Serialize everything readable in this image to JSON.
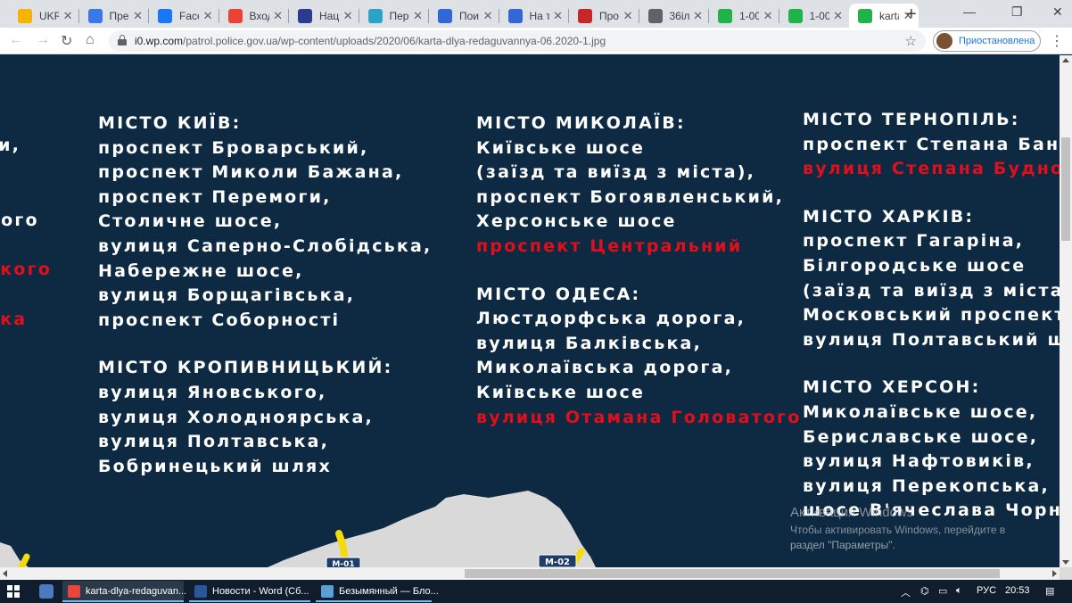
{
  "browser": {
    "tabs": [
      {
        "title": "UKR",
        "favicon": "ukr-icon",
        "color": "#f4b400"
      },
      {
        "title": "Пре",
        "favicon": "chart-icon",
        "color": "#3b78e7"
      },
      {
        "title": "Face",
        "favicon": "facebook-icon",
        "color": "#1877f2"
      },
      {
        "title": "Вход",
        "favicon": "gmail-icon",
        "color": "#ea4335"
      },
      {
        "title": "Нац",
        "favicon": "emblem-icon",
        "color": "#2b3b8f"
      },
      {
        "title": "Пер",
        "favicon": "diamond-icon",
        "color": "#2aa3c9"
      },
      {
        "title": "Пои",
        "favicon": "globe-icon",
        "color": "#3367d6"
      },
      {
        "title": "На т",
        "favicon": "globe-icon",
        "color": "#3367d6"
      },
      {
        "title": "Про",
        "favicon": "shield-icon",
        "color": "#c62828"
      },
      {
        "title": "36іл",
        "favicon": "link-icon",
        "color": "#5f6368"
      },
      {
        "title": "1-00",
        "favicon": "green-bolt-icon",
        "color": "#1fb34a"
      },
      {
        "title": "1-00",
        "favicon": "green-bolt-icon",
        "color": "#1fb34a"
      },
      {
        "title": "karta",
        "favicon": "green-bolt-icon",
        "color": "#1fb34a",
        "active": true
      }
    ],
    "new_tab": "+",
    "window_controls": {
      "minimize": "—",
      "restore": "❐",
      "close": "✕"
    },
    "url_host": "i0.wp.com",
    "url_path": "/patrol.police.gov.ua/wp-content/uploads/2020/06/karta-dlya-redaguvannya-06.2020-1.jpg",
    "profile_label": "Приостановлена"
  },
  "map_image": {
    "left_partial": [
      {
        "text": "ги,",
        "red": false
      },
      {
        "text": "кого",
        "red": false
      },
      {
        "text": "ького",
        "red": true
      },
      {
        "text": "ька",
        "red": true
      }
    ],
    "columns": [
      {
        "groups": [
          {
            "title": "МІСТО КИЇВ:",
            "streets": [
              {
                "text": "проспект Броварський,",
                "red": false
              },
              {
                "text": "проспект Миколи Бажана,",
                "red": false
              },
              {
                "text": "проспект Перемоги,",
                "red": false
              },
              {
                "text": "Столичне шосе,",
                "red": false
              },
              {
                "text": "вулиця Саперно-Слобідська,",
                "red": false
              },
              {
                "text": "Набережне шосе,",
                "red": false
              },
              {
                "text": "вулиця Борщагівська,",
                "red": false
              },
              {
                "text": "проспект Соборності",
                "red": false
              }
            ]
          },
          {
            "title": "МІСТО КРОПИВНИЦЬКИЙ:",
            "streets": [
              {
                "text": "вулиця Яновського,",
                "red": false
              },
              {
                "text": "вулиця Холодноярська,",
                "red": false
              },
              {
                "text": "вулиця Полтавська,",
                "red": false
              },
              {
                "text": "Бобринецький шлях",
                "red": false
              }
            ]
          }
        ]
      },
      {
        "groups": [
          {
            "title": "МІСТО МИКОЛАЇВ:",
            "streets": [
              {
                "text": "Київське шосе",
                "red": false
              },
              {
                "text": "(заїзд та виїзд з міста),",
                "red": false
              },
              {
                "text": "проспект Богоявленський,",
                "red": false
              },
              {
                "text": "Херсонське шосе",
                "red": false
              },
              {
                "text": "проспект Центральний",
                "red": true
              }
            ]
          },
          {
            "title": "МІСТО ОДЕСА:",
            "streets": [
              {
                "text": "Люстдорфська дорога,",
                "red": false
              },
              {
                "text": "вулиця Балківська,",
                "red": false
              },
              {
                "text": "Миколаївська дорога,",
                "red": false
              },
              {
                "text": "Київське шосе",
                "red": false
              },
              {
                "text": "вулиця Отамана Головатого",
                "red": true
              }
            ]
          }
        ]
      },
      {
        "groups": [
          {
            "title": "МІСТО ТЕРНОПІЛЬ:",
            "streets": [
              {
                "text": "проспект Степана Банде",
                "red": false
              },
              {
                "text": "вулиця Степана Будного",
                "red": true
              }
            ]
          },
          {
            "title": "МІСТО ХАРКІВ:",
            "streets": [
              {
                "text": "проспект Гагаріна,",
                "red": false
              },
              {
                "text": "Білгородське шосе",
                "red": false
              },
              {
                "text": "(заїзд та виїзд з міста),",
                "red": false
              },
              {
                "text": "Московський проспект,",
                "red": false
              },
              {
                "text": "вулиця Полтавський шл",
                "red": false
              }
            ]
          },
          {
            "title": "МІСТО ХЕРСОН:",
            "streets": [
              {
                "text": "Миколаївське шосе,",
                "red": false
              },
              {
                "text": "Бериславське шосе,",
                "red": false
              },
              {
                "text": "вулиця Нафтовиків,",
                "red": false
              },
              {
                "text": "вулиця Перекопська,",
                "red": false
              },
              {
                "text": "шосе В'ячеслава Чорно",
                "red": false
              }
            ]
          }
        ]
      }
    ],
    "road_labels": [
      "М-01",
      "М-02"
    ],
    "colors": {
      "background": "#0e2a43",
      "land": "#d9d9d9",
      "highlight": "#e10f1b",
      "road": "#f5d90a"
    }
  },
  "watermark": {
    "line1": "Активация Windows",
    "line2": "Чтобы активировать Windows, перейдите в",
    "line3": "раздел \"Параметры\"."
  },
  "taskbar": {
    "items": [
      {
        "label": "karta-dlya-redaguvan...",
        "icon": "chrome-icon",
        "active": true
      },
      {
        "label": "Новости - Word (Сб...",
        "icon": "word-icon",
        "active": false
      },
      {
        "label": "Безымянный — Бло...",
        "icon": "notepad-icon",
        "active": false
      }
    ],
    "lang": "РУС",
    "time": "20:53"
  }
}
